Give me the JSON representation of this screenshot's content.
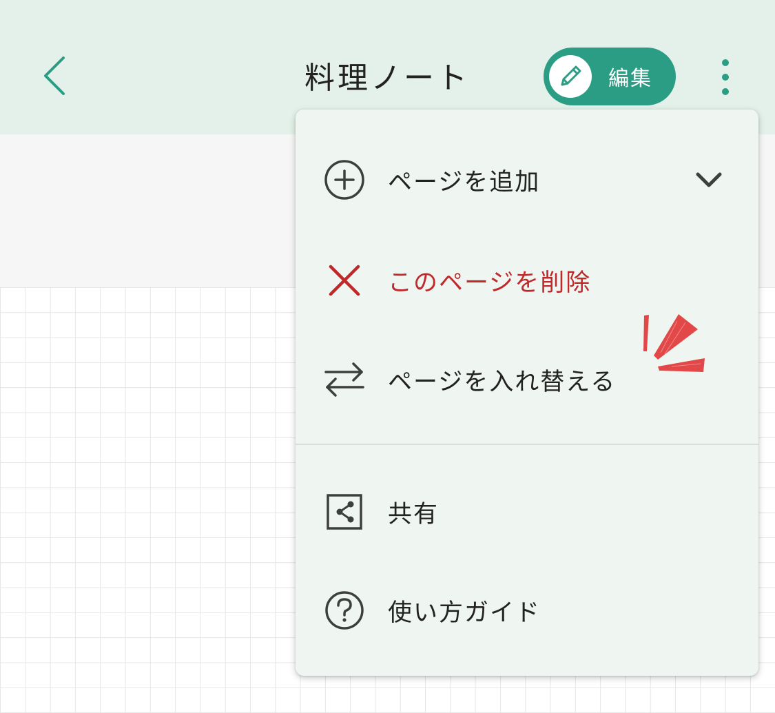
{
  "header": {
    "title": "料理ノート",
    "edit_label": "編集",
    "icons": [
      "chevron-left-icon",
      "pencil-icon",
      "more-vertical-icon"
    ],
    "accent_color": "#2a9d84",
    "background_color": "#e3f1ea"
  },
  "menu": {
    "items": [
      {
        "label": "ページを追加",
        "icon": "plus-circle-icon",
        "trailing_icon": "chevron-down-icon"
      },
      {
        "label": "このページを削除",
        "icon": "close-icon",
        "color": "#c0282a"
      },
      {
        "label": "ページを入れ替える",
        "icon": "swap-arrows-icon"
      },
      {
        "label": "共有",
        "icon": "share-icon"
      },
      {
        "label": "使い方ガイド",
        "icon": "help-circle-icon"
      }
    ]
  }
}
